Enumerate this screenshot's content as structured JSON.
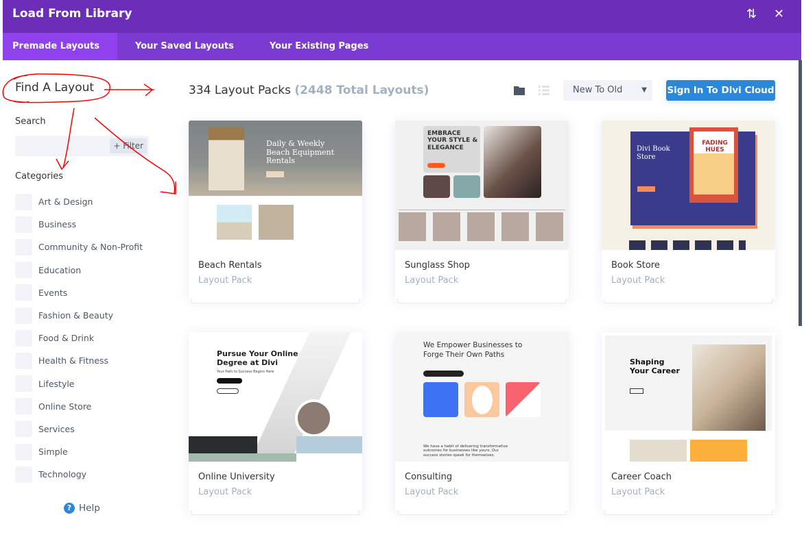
{
  "header": {
    "title": "Load From Library",
    "sort_icon": "sort-arrows-icon",
    "close_icon": "close-icon"
  },
  "tabs": [
    {
      "label": "Premade Layouts",
      "active": true
    },
    {
      "label": "Your Saved Layouts"
    },
    {
      "label": "Your Existing Pages"
    }
  ],
  "sidebar": {
    "heading": "Find A Layout",
    "search_label": "Search",
    "search_value": "",
    "filter_label": "+ Filter",
    "categories_label": "Categories",
    "categories": [
      "Art & Design",
      "Business",
      "Community & Non-Profit",
      "Education",
      "Events",
      "Fashion & Beauty",
      "Food & Drink",
      "Health & Fitness",
      "Lifestyle",
      "Online Store",
      "Services",
      "Simple",
      "Technology"
    ],
    "help_label": "Help"
  },
  "toolbar": {
    "count": "334 Layout Packs",
    "total": "(2448 Total Layouts)",
    "sort_value": "New To Old",
    "signin_label": "Sign In To Divi Cloud"
  },
  "colors": {
    "header": "#6c2eb9",
    "tabbar": "#7b3bd0",
    "active_tab": "#8f42ec",
    "primary": "#2b87da",
    "annotation": "#ff0000"
  },
  "cards": [
    {
      "title": "Beach Rentals",
      "subtitle": "Layout Pack",
      "thumb_text": "Daily & Weekly Beach Equipment Rentals"
    },
    {
      "title": "Sunglass Shop",
      "subtitle": "Layout Pack",
      "thumb_text": "EMBRACE YOUR STYLE & ELEGANCE"
    },
    {
      "title": "Book Store",
      "subtitle": "Layout Pack",
      "thumb_text": "Divi Book Store",
      "thumb_text2": "FADING HUES"
    },
    {
      "title": "Online University",
      "subtitle": "Layout Pack",
      "thumb_text": "Pursue Your Online Degree at Divi",
      "thumb_text2": "Your Path to Success Begins Here"
    },
    {
      "title": "Consulting",
      "subtitle": "Layout Pack",
      "thumb_text": "We Empower Businesses to Forge Their Own Paths",
      "thumb_text2": "We have a habit of delivering transformative outcomes for businesses like yours. Our success stories speak for themselves."
    },
    {
      "title": "Career Coach",
      "subtitle": "Layout Pack",
      "thumb_text": "Shaping Your Career"
    }
  ]
}
